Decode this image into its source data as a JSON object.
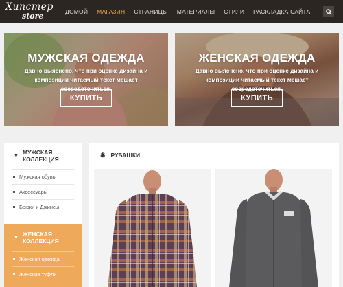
{
  "header": {
    "logo_script": "Хипстер",
    "logo_store": "store",
    "nav": [
      {
        "label": "ДОМОЙ",
        "active": false
      },
      {
        "label": "МАГАЗИН",
        "active": true
      },
      {
        "label": "СТРАНИЦЫ",
        "active": false
      },
      {
        "label": "МАТЕРИАЛЫ",
        "active": false
      },
      {
        "label": "СТИЛИ",
        "active": false
      },
      {
        "label": "РАСКЛАДКА САЙТА",
        "active": false
      }
    ],
    "search_icon": "search-icon"
  },
  "heroes": {
    "men": {
      "title": "МУЖСКАЯ ОДЕЖДА",
      "description": "Давно выяснено, что при оценке дизайна и композиции читаемый текст мешает сосредоточиться.",
      "button": "КУПИТЬ"
    },
    "women": {
      "title": "ЖЕНСКАЯ ОДЕЖДА",
      "description": "Давно выяснено, что при оценке дизайна и композиции читаемый текст мешает сосредоточиться.",
      "button": "КУПИТЬ"
    }
  },
  "sidebar": {
    "men_heading": "МУЖСКАЯ КОЛЛЕКЦИЯ",
    "men_items": [
      "Мужская обувь",
      "Аксессуары",
      "Брюки и Джинсы"
    ],
    "women_heading": "ЖЕНСКАЯ КОЛЛЕКЦИЯ",
    "women_items": [
      "Женская одежда",
      "Женские туфли"
    ]
  },
  "main": {
    "heading": "РУБАШКИ",
    "heading_icon": "star-icon"
  },
  "colors": {
    "header_bg": "#2c2622",
    "accent": "#e8a64b",
    "sidebar_women_bg": "#efa95a"
  }
}
